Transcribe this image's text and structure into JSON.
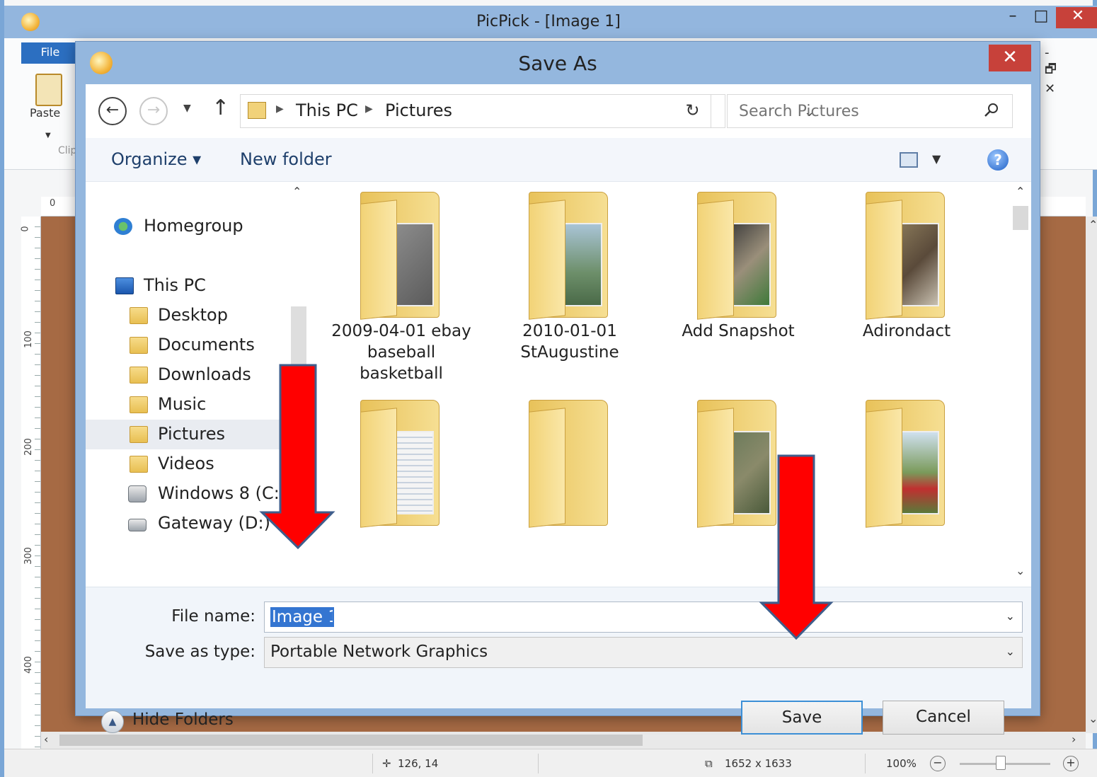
{
  "app": {
    "title": "PicPick - [Image 1]",
    "file_tab": "File",
    "paste_label": "Paste",
    "clipboard_group": "Clip",
    "window_controls": {
      "minimize": "–",
      "maximize": "□",
      "close": "✕"
    },
    "mdi_controls": "- 🗗 ✕"
  },
  "rulers": {
    "top": [
      "0"
    ],
    "left": [
      "0",
      "100",
      "200",
      "300",
      "400"
    ]
  },
  "status": {
    "cursor_position": "126, 14",
    "image_size": "1652 x 1633",
    "zoom": "100%",
    "zoom_level_fraction": 0.45
  },
  "dialog": {
    "title": "Save As",
    "close": "✕",
    "breadcrumb": [
      "This PC",
      "Pictures"
    ],
    "search_placeholder": "Search Pictures",
    "organize": "Organize ▾",
    "new_folder": "New folder",
    "help": "?",
    "nav_items": [
      {
        "label": "Homegroup",
        "icon": "homegroup-icon"
      },
      {
        "label": "This PC",
        "icon": "pc-icon"
      },
      {
        "label": "Desktop",
        "icon": "desktop-folder-icon"
      },
      {
        "label": "Documents",
        "icon": "documents-folder-icon"
      },
      {
        "label": "Downloads",
        "icon": "downloads-folder-icon"
      },
      {
        "label": "Music",
        "icon": "music-folder-icon"
      },
      {
        "label": "Pictures",
        "icon": "pictures-folder-icon",
        "selected": true
      },
      {
        "label": "Videos",
        "icon": "videos-folder-icon"
      },
      {
        "label": "Windows 8 (C:)",
        "icon": "drive-icon"
      },
      {
        "label": "Gateway (D:)",
        "icon": "drive-icon"
      }
    ],
    "folders": [
      {
        "line1": "2009-04-01 ebay",
        "line2": "baseball",
        "line3": "basketball"
      },
      {
        "line1": "2010-01-01",
        "line2": "StAugustine",
        "line3": ""
      },
      {
        "line1": "Add Snapshot",
        "line2": "",
        "line3": ""
      },
      {
        "line1": "Adirondact",
        "line2": "",
        "line3": ""
      },
      {
        "line1": "",
        "line2": "",
        "line3": ""
      },
      {
        "line1": "",
        "line2": "",
        "line3": ""
      },
      {
        "line1": "",
        "line2": "",
        "line3": ""
      },
      {
        "line1": "",
        "line2": "",
        "line3": ""
      }
    ],
    "file_name_label": "File name:",
    "file_name_value": "Image 1",
    "save_type_label": "Save as type:",
    "save_type_value": "Portable Network Graphics",
    "hide_folders": "Hide Folders",
    "save_button": "Save",
    "cancel_button": "Cancel"
  },
  "colors": {
    "titlebar": "#93b6de",
    "close_red": "#c7413a",
    "canvas_brown": "#a66a44",
    "annotation_red": "#ff0000",
    "selection_blue": "#3475d1"
  }
}
